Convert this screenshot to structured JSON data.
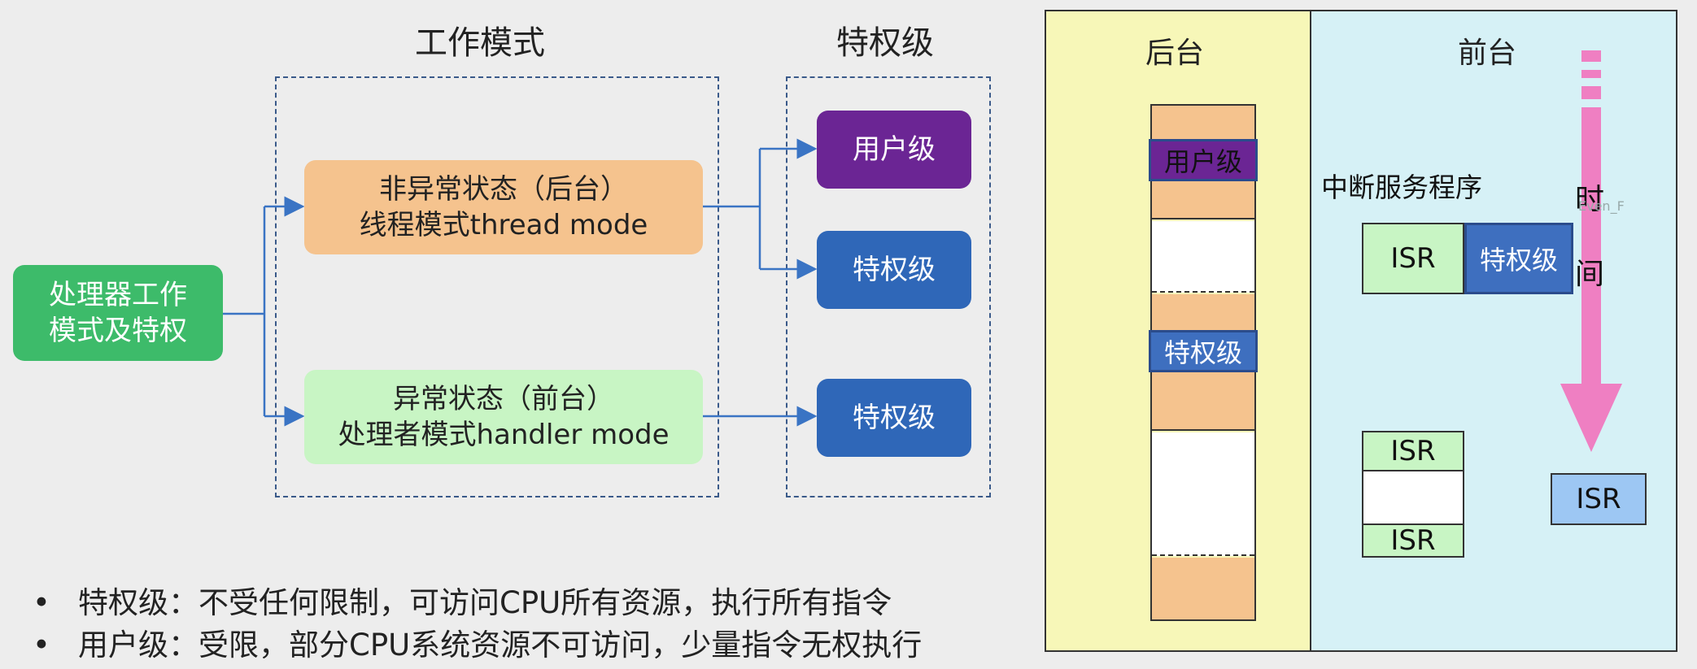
{
  "left": {
    "heading_mode": "工作模式",
    "heading_privilege": "特权级",
    "processor_line1": "处理器工作",
    "processor_line2": "模式及特权",
    "thread_line1": "非异常状态（后台）",
    "thread_line2": "线程模式thread mode",
    "handler_line1": "异常状态（前台）",
    "handler_line2": "处理者模式handler mode",
    "user_level": "用户级",
    "priv_level_1": "特权级",
    "priv_level_2": "特权级"
  },
  "bullets": [
    {
      "dot": "•",
      "text": "特权级：不受任何限制，可访问CPU所有资源，执行所有指令"
    },
    {
      "dot": "•",
      "text": "用户级：受限，部分CPU系统资源不可访问，少量指令无权执行"
    }
  ],
  "right": {
    "background_title": "后台",
    "foreground_title": "前台",
    "stack_user_label": "用户级",
    "stack_priv_label": "特权级",
    "isr_service": "中断服务程序",
    "isr": "ISR",
    "isr_priv": "特权级",
    "isr_upper": "ISR",
    "isr_lower": "ISR",
    "isr_nested": "ISR",
    "time_char_1": "时",
    "time_char_2": "间",
    "watermark": "Even_F"
  },
  "colors": {
    "green_box": "#3dbb6a",
    "orange_box": "#f5c38e",
    "light_green_box": "#c8f5c4",
    "purple": "#6b2594",
    "blue": "#2f67b8",
    "yellow_panel": "#f7f7b8",
    "cyan_panel": "#d6f1f6",
    "pink_arrow": "#ef7fc2",
    "isr_blue": "#9dc7f3"
  }
}
